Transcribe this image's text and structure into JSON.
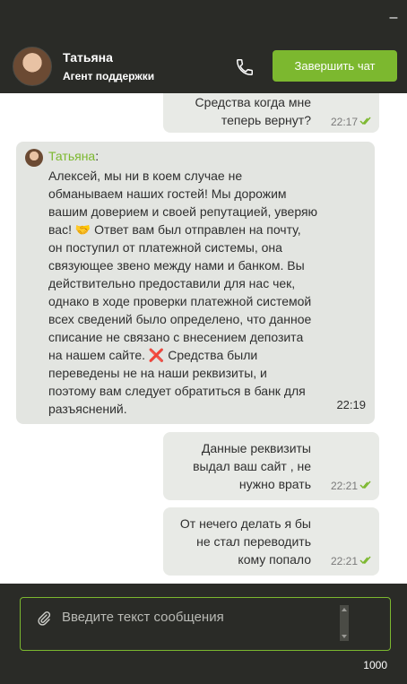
{
  "window": {
    "minimize_label": "–"
  },
  "header": {
    "agent_name": "Татьяна",
    "agent_role": "Агент поддержки",
    "end_chat_label": "Завершить чат",
    "accent_color": "#7cb82f"
  },
  "messages": [
    {
      "direction": "out",
      "lines": [
        "Средства когда мне",
        "теперь вернут?"
      ],
      "time": "22:17",
      "status": "read"
    },
    {
      "direction": "in",
      "author": "Татьяна",
      "text_lines": [
        "Алексей, мы ни в коем случае не",
        "обманываем наших гостей! Мы дорожим",
        "вашим доверием и своей репутацией, уверяю",
        "вас! 🤝 Ответ вам был отправлен на почту,",
        "он поступил от платежной системы, она",
        "связующее звено между нами и банком. Вы",
        "действительно предоставили для нас чек,",
        "однако в ходе проверки платежной системой",
        "всех сведений было определено, что данное",
        "списание не связано с внесением депозита",
        "на нашем сайте. ❌ Средства были",
        "переведены не на наши реквизиты, и",
        "поэтому вам следует обратиться в банк для",
        "разъяснений."
      ],
      "time": "22:19"
    },
    {
      "direction": "out",
      "lines": [
        "Данные реквизиты",
        "выдал ваш сайт , не",
        "нужно врать"
      ],
      "time": "22:21",
      "status": "read"
    },
    {
      "direction": "out",
      "lines": [
        "От нечего делать я бы",
        "не стал переводить",
        "кому попало"
      ],
      "time": "22:21",
      "status": "read"
    }
  ],
  "composer": {
    "placeholder": "Введите текст сообщения",
    "char_counter": "1000"
  }
}
